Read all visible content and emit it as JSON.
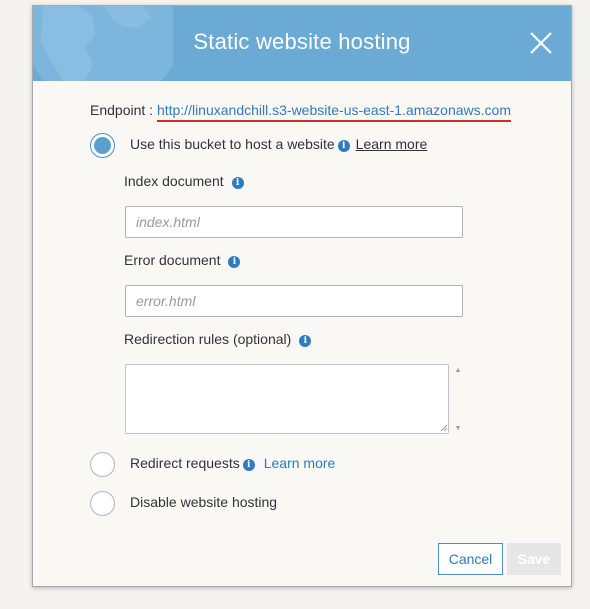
{
  "dialog": {
    "title": "Static website hosting",
    "close_icon": "close-icon",
    "endpoint_label": "Endpoint : ",
    "endpoint_url": "http://linuxandchill.s3-website-us-east-1.amazonaws.com"
  },
  "options": {
    "host": {
      "label": "Use this bucket to host a website",
      "learn_more": "Learn more",
      "selected": true
    },
    "redirect": {
      "label": "Redirect requests",
      "learn_more": "Learn more",
      "selected": false
    },
    "disable": {
      "label": "Disable website hosting",
      "selected": false
    }
  },
  "fields": {
    "index": {
      "label": "Index document",
      "placeholder": "index.html",
      "value": ""
    },
    "error": {
      "label": "Error document",
      "placeholder": "error.html",
      "value": ""
    },
    "redirection": {
      "label": "Redirection rules (optional)",
      "value": ""
    }
  },
  "buttons": {
    "cancel": "Cancel",
    "save": "Save"
  },
  "colors": {
    "header": "#6aaad4",
    "accent": "#2f7bbf",
    "underline": "#c9302c"
  }
}
